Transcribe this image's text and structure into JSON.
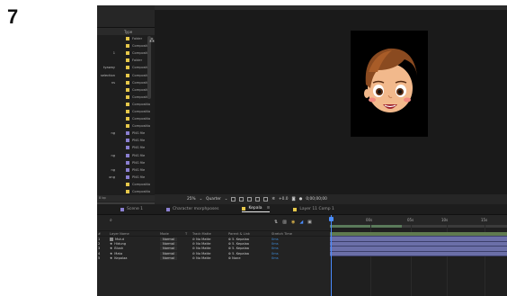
{
  "step_number": "7",
  "project_panel": {
    "type_header": "Type",
    "rows": [
      {
        "name": "",
        "type": "Folder",
        "color": "#e6c84a"
      },
      {
        "name": "",
        "type": "Compositio",
        "color": "#e6c84a"
      },
      {
        "name": "1",
        "type": "Compositio",
        "color": "#e6c84a"
      },
      {
        "name": "",
        "type": "Folder",
        "color": "#e6c84a"
      },
      {
        "name": "tyaway",
        "type": "Compositio",
        "color": "#e6c84a"
      },
      {
        "name": "selection",
        "type": "Compositio",
        "color": "#e6c84a"
      },
      {
        "name": "ns",
        "type": "Compositio",
        "color": "#e6c84a"
      },
      {
        "name": "",
        "type": "Compositio",
        "color": "#e6c84a"
      },
      {
        "name": "",
        "type": "Compositio",
        "color": "#e6c84a"
      },
      {
        "name": "",
        "type": "Compositio",
        "color": "#e6c84a"
      },
      {
        "name": "",
        "type": "Compositio",
        "color": "#e6c84a"
      },
      {
        "name": "",
        "type": "Compositio",
        "color": "#e6c84a"
      },
      {
        "name": "",
        "type": "Compositio",
        "color": "#e6c84a"
      },
      {
        "name": "ng",
        "type": "PNG file",
        "color": "#8a7fd0"
      },
      {
        "name": "",
        "type": "PNG file",
        "color": "#8a7fd0"
      },
      {
        "name": "",
        "type": "PNG file",
        "color": "#8a7fd0"
      },
      {
        "name": "ng",
        "type": "PNG file",
        "color": "#8a7fd0"
      },
      {
        "name": "",
        "type": "PNG file",
        "color": "#8a7fd0"
      },
      {
        "name": "ng",
        "type": "PNG file",
        "color": "#8a7fd0"
      },
      {
        "name": "ong",
        "type": "PNG file",
        "color": "#8a7fd0"
      },
      {
        "name": "",
        "type": "Compositio",
        "color": "#e6c84a"
      },
      {
        "name": "",
        "type": "Compositio",
        "color": "#e6c84a"
      },
      {
        "name": "",
        "type": "Compositio",
        "color": "#e6c84a"
      },
      {
        "name": "",
        "type": "Compositio",
        "color": "#e6c84a"
      },
      {
        "name": "ctions",
        "type": "Compositio",
        "color": "#e6c84a"
      }
    ],
    "footer": "8 bp"
  },
  "viewer": {
    "zoom": "25%",
    "resolution": "Quarter",
    "exposure": "+0.0",
    "timecode": "0;00;00;00"
  },
  "tabs": [
    {
      "label": "Scene 1",
      "color": "#8a7fd0",
      "active": false
    },
    {
      "label": "Character morphposes",
      "color": "#8a7fd0",
      "active": false
    },
    {
      "label": "Kepala",
      "color": "#e6c84a",
      "active": true,
      "close": "≡"
    },
    {
      "label": "Layer 11 Comp 1",
      "color": "#e6c84a",
      "active": false
    }
  ],
  "timeline": {
    "headers": {
      "name": "Layer Name",
      "mode": "Mode",
      "t": "T",
      "track_matte": "Track Matte",
      "parent": "Parent & Link",
      "stretch": "Stretch Time"
    },
    "layers": [
      {
        "num": "1",
        "name": "Mulut",
        "mode": "Normal",
        "matte": "No Matte",
        "parent": "5. Kepalaa",
        "stretch": "0ms"
      },
      {
        "num": "2",
        "name": "Hidung",
        "mode": "Normal",
        "matte": "No Matte",
        "parent": "5. Kepalaa",
        "stretch": "0ms"
      },
      {
        "num": "3",
        "name": "Blush",
        "mode": "Normal",
        "matte": "No Matte",
        "parent": "5. Kepalaa",
        "stretch": "0ms"
      },
      {
        "num": "4",
        "name": "Mata",
        "mode": "Normal",
        "matte": "No Matte",
        "parent": "5. Kepalaa",
        "stretch": "0ms"
      },
      {
        "num": "5",
        "name": "Kepalaa",
        "mode": "Normal",
        "matte": "No Matte",
        "parent": "None",
        "stretch": "0ms"
      }
    ],
    "ruler": [
      "00s",
      "05s",
      "10s",
      "15s"
    ]
  }
}
